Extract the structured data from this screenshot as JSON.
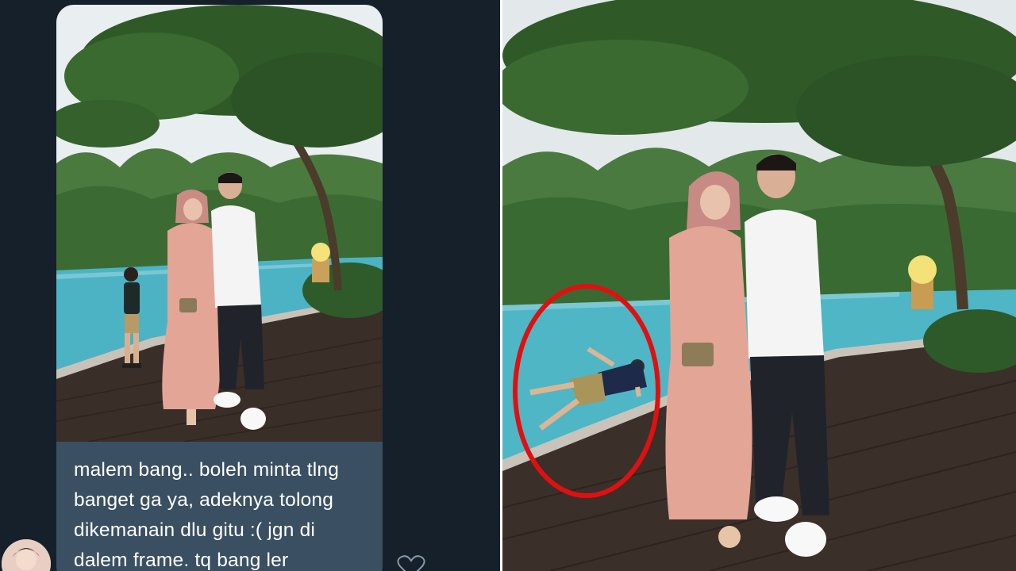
{
  "message": {
    "lines": [
      "malem bang.. boleh minta tlng",
      "banget ga ya, adeknya tolong",
      "dikemanain dlu gitu :( jgn di",
      "dalem frame. tq bang ler"
    ]
  },
  "icons": {
    "avatar": "user-avatar",
    "like": "heart-icon"
  },
  "colors": {
    "background": "#15202b",
    "bubble": "#3b4f62",
    "highlight_circle": "#e01010"
  }
}
